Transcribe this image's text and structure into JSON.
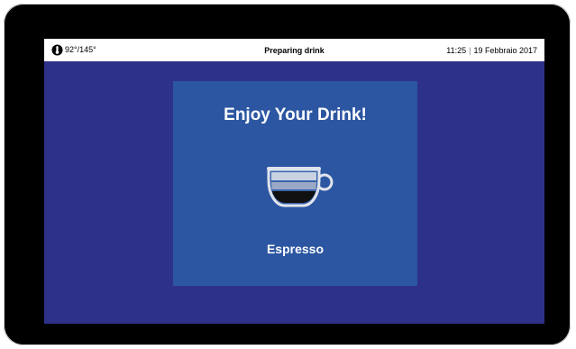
{
  "status_bar": {
    "temperature": "92°/145°",
    "title": "Preparing drink",
    "time": "11:25",
    "separator": "|",
    "date": "19 Febbraio 2017"
  },
  "card": {
    "title": "Enjoy Your Drink!",
    "drink_name": "Espresso",
    "icon": "espresso-cup-icon"
  },
  "colors": {
    "screen_background": "#2e3189",
    "card_background": "#2c56a1",
    "status_bar_background": "#ffffff",
    "cup_coffee": "#111111",
    "cup_foam": "#e0e4ec"
  }
}
